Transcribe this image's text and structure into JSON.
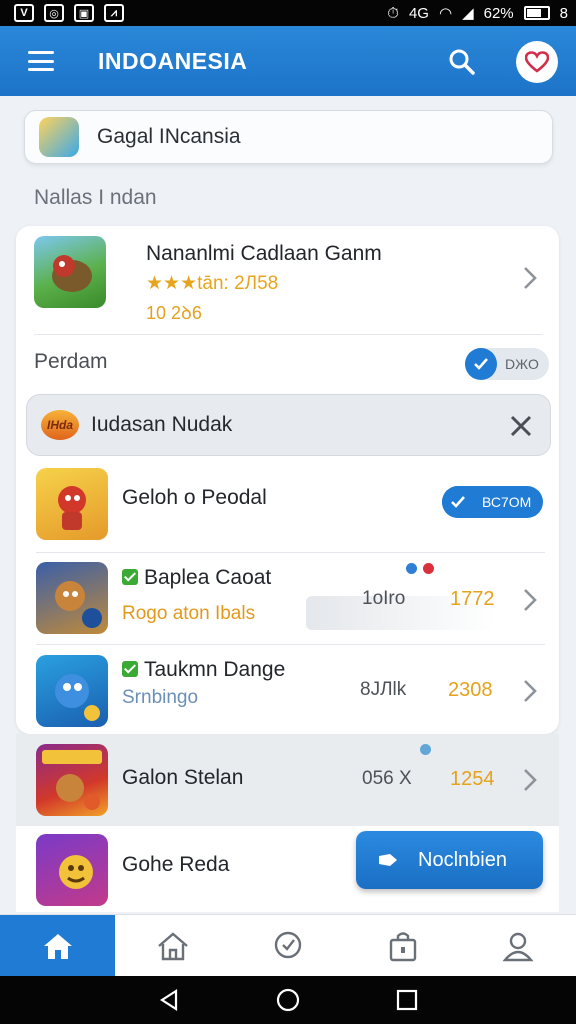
{
  "status_bar": {
    "signal_text": "4G",
    "battery_percent": "62%",
    "battery_suffix": "8"
  },
  "app_bar": {
    "title": "INDOANESIA"
  },
  "search": {
    "text": "Gagal INcansia"
  },
  "section_title": "Nallas I ndan",
  "featured": {
    "title": "Nananlmi Cadlaan Ganm",
    "rating": "★★★tān: 2Л58",
    "count": "10 2ꝺ6"
  },
  "sub_header": {
    "label": "Perdam",
    "badge": "DЖO"
  },
  "filter": {
    "logo_text": "IHda",
    "text": "Iudasan Nudak"
  },
  "rows": [
    {
      "title": "Geloh o Peodal",
      "badge": "ВС7ОМ"
    },
    {
      "title": "Baplea Caoat",
      "subtitle": "Rogo aton Ibals",
      "stat1": "1oIro",
      "stat2": "1772"
    },
    {
      "title": "Taukmn Dange",
      "subtitle": "Srnbingo",
      "stat1": "8JЛlk",
      "stat2": "2308"
    },
    {
      "title": "Galon Stelan",
      "stat1": "056 X",
      "stat2": "1254"
    },
    {
      "title": "Gohe Reda"
    }
  ],
  "fab": {
    "label": "Noclnbien"
  },
  "colors": {
    "primary": "#1f7bd4",
    "accent_gold": "#e5a21a",
    "check_green": "#3aaa35"
  },
  "icons": [
    "menu-icon",
    "search-icon",
    "heart-icon",
    "chevron-right-icon",
    "close-icon",
    "home-icon",
    "chat-icon",
    "bag-icon",
    "profile-icon"
  ]
}
